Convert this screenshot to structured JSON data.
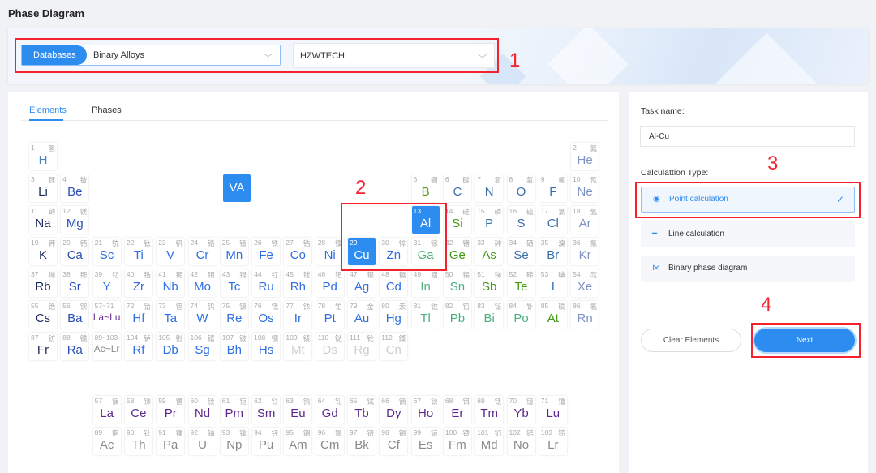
{
  "page_title": "Phase Diagram",
  "database": {
    "label": "Databases",
    "value": "Binary Alloys",
    "vendor": "HZWTECH"
  },
  "tabs": [
    {
      "label": "Elements",
      "active": true
    },
    {
      "label": "Phases",
      "active": false
    }
  ],
  "va_button": "VA",
  "category_colors": {
    "alkali": "#1c2b5c",
    "alkaline": "#2a4fb5",
    "transition": "#2f6fe4",
    "lanthanide_link": "#6a2e8f",
    "actinide_link": "#8c8c8c",
    "synthetic": "#cfcfcf",
    "boron": "#5c9a12",
    "nonmetal": "#3a6fa8",
    "noble": "#7f93c4",
    "poor": "#4bb07d",
    "metalloid": "#3f9a10",
    "hydrogen": "#4a84b6",
    "lanthanide": "#5b2a8c",
    "actinide": "#8a8a8a"
  },
  "selection_color": "#2d8cf0",
  "selected": [
    13,
    29
  ],
  "elements": [
    [
      1,
      "H",
      "氢",
      1,
      1,
      "hydrogen"
    ],
    [
      2,
      "He",
      "氦",
      1,
      18,
      "noble"
    ],
    [
      3,
      "Li",
      "锂",
      2,
      1,
      "alkali"
    ],
    [
      4,
      "Be",
      "铍",
      2,
      2,
      "alkaline"
    ],
    [
      5,
      "B",
      "硼",
      2,
      13,
      "boron"
    ],
    [
      6,
      "C",
      "碳",
      2,
      14,
      "nonmetal"
    ],
    [
      7,
      "N",
      "氮",
      2,
      15,
      "nonmetal"
    ],
    [
      8,
      "O",
      "氧",
      2,
      16,
      "nonmetal"
    ],
    [
      9,
      "F",
      "氟",
      2,
      17,
      "nonmetal"
    ],
    [
      10,
      "Ne",
      "氖",
      2,
      18,
      "noble"
    ],
    [
      11,
      "Na",
      "钠",
      3,
      1,
      "alkali"
    ],
    [
      12,
      "Mg",
      "镁",
      3,
      2,
      "alkaline"
    ],
    [
      13,
      "Al",
      "铝",
      3,
      13,
      "poor"
    ],
    [
      14,
      "Si",
      "硅",
      3,
      14,
      "metalloid"
    ],
    [
      15,
      "P",
      "磷",
      3,
      15,
      "nonmetal"
    ],
    [
      16,
      "S",
      "硫",
      3,
      16,
      "nonmetal"
    ],
    [
      17,
      "Cl",
      "氯",
      3,
      17,
      "nonmetal"
    ],
    [
      18,
      "Ar",
      "氩",
      3,
      18,
      "noble"
    ],
    [
      19,
      "K",
      "钾",
      4,
      1,
      "alkali"
    ],
    [
      20,
      "Ca",
      "钙",
      4,
      2,
      "alkaline"
    ],
    [
      21,
      "Sc",
      "钪",
      4,
      3,
      "transition"
    ],
    [
      22,
      "Ti",
      "钛",
      4,
      4,
      "transition"
    ],
    [
      23,
      "V",
      "钒",
      4,
      5,
      "transition"
    ],
    [
      24,
      "Cr",
      "铬",
      4,
      6,
      "transition"
    ],
    [
      25,
      "Mn",
      "锰",
      4,
      7,
      "transition"
    ],
    [
      26,
      "Fe",
      "铁",
      4,
      8,
      "transition"
    ],
    [
      27,
      "Co",
      "钴",
      4,
      9,
      "transition"
    ],
    [
      28,
      "Ni",
      "镍",
      4,
      10,
      "transition"
    ],
    [
      29,
      "Cu",
      "铜",
      4,
      11,
      "transition"
    ],
    [
      30,
      "Zn",
      "锌",
      4,
      12,
      "transition"
    ],
    [
      31,
      "Ga",
      "镓",
      4,
      13,
      "poor"
    ],
    [
      32,
      "Ge",
      "锗",
      4,
      14,
      "metalloid"
    ],
    [
      33,
      "As",
      "砷",
      4,
      15,
      "metalloid"
    ],
    [
      34,
      "Se",
      "硒",
      4,
      16,
      "nonmetal"
    ],
    [
      35,
      "Br",
      "溴",
      4,
      17,
      "nonmetal"
    ],
    [
      36,
      "Kr",
      "氪",
      4,
      18,
      "noble"
    ],
    [
      37,
      "Rb",
      "铷",
      5,
      1,
      "alkali"
    ],
    [
      38,
      "Sr",
      "锶",
      5,
      2,
      "alkaline"
    ],
    [
      39,
      "Y",
      "钇",
      5,
      3,
      "transition"
    ],
    [
      40,
      "Zr",
      "锆",
      5,
      4,
      "transition"
    ],
    [
      41,
      "Nb",
      "铌",
      5,
      5,
      "transition"
    ],
    [
      42,
      "Mo",
      "钼",
      5,
      6,
      "transition"
    ],
    [
      43,
      "Tc",
      "锝",
      5,
      7,
      "transition"
    ],
    [
      44,
      "Ru",
      "钌",
      5,
      8,
      "transition"
    ],
    [
      45,
      "Rh",
      "铑",
      5,
      9,
      "transition"
    ],
    [
      46,
      "Pd",
      "钯",
      5,
      10,
      "transition"
    ],
    [
      47,
      "Ag",
      "银",
      5,
      11,
      "transition"
    ],
    [
      48,
      "Cd",
      "镉",
      5,
      12,
      "transition"
    ],
    [
      49,
      "In",
      "铟",
      5,
      13,
      "poor"
    ],
    [
      50,
      "Sn",
      "锡",
      5,
      14,
      "poor"
    ],
    [
      51,
      "Sb",
      "锑",
      5,
      15,
      "metalloid"
    ],
    [
      52,
      "Te",
      "碲",
      5,
      16,
      "metalloid"
    ],
    [
      53,
      "I",
      "碘",
      5,
      17,
      "nonmetal"
    ],
    [
      54,
      "Xe",
      "氙",
      5,
      18,
      "noble"
    ],
    [
      55,
      "Cs",
      "铯",
      6,
      1,
      "alkali"
    ],
    [
      56,
      "Ba",
      "钡",
      6,
      2,
      "alkaline"
    ],
    [
      "57~71",
      "La~Lu",
      "",
      6,
      3,
      "lanthanide_link"
    ],
    [
      72,
      "Hf",
      "铪",
      6,
      4,
      "transition"
    ],
    [
      73,
      "Ta",
      "钽",
      6,
      5,
      "transition"
    ],
    [
      74,
      "W",
      "钨",
      6,
      6,
      "transition"
    ],
    [
      75,
      "Re",
      "铼",
      6,
      7,
      "transition"
    ],
    [
      76,
      "Os",
      "锇",
      6,
      8,
      "transition"
    ],
    [
      77,
      "Ir",
      "铱",
      6,
      9,
      "transition"
    ],
    [
      78,
      "Pt",
      "铂",
      6,
      10,
      "transition"
    ],
    [
      79,
      "Au",
      "金",
      6,
      11,
      "transition"
    ],
    [
      80,
      "Hg",
      "汞",
      6,
      12,
      "transition"
    ],
    [
      81,
      "Tl",
      "铊",
      6,
      13,
      "poor"
    ],
    [
      82,
      "Pb",
      "铅",
      6,
      14,
      "poor"
    ],
    [
      83,
      "Bi",
      "铋",
      6,
      15,
      "poor"
    ],
    [
      84,
      "Po",
      "钋",
      6,
      16,
      "poor"
    ],
    [
      85,
      "At",
      "砹",
      6,
      17,
      "metalloid"
    ],
    [
      86,
      "Rn",
      "氡",
      6,
      18,
      "noble"
    ],
    [
      87,
      "Fr",
      "钫",
      7,
      1,
      "alkali"
    ],
    [
      88,
      "Ra",
      "镭",
      7,
      2,
      "alkaline"
    ],
    [
      "89~103",
      "Ac~Lr",
      "",
      7,
      3,
      "actinide_link"
    ],
    [
      104,
      "Rf",
      "𬬻",
      7,
      4,
      "transition"
    ],
    [
      105,
      "Db",
      "𬭊",
      7,
      5,
      "transition"
    ],
    [
      106,
      "Sg",
      "𬭳",
      7,
      6,
      "transition"
    ],
    [
      107,
      "Bh",
      "𬭛",
      7,
      7,
      "transition"
    ],
    [
      108,
      "Hs",
      "𬭶",
      7,
      8,
      "transition"
    ],
    [
      109,
      "Mt",
      "鿏",
      7,
      9,
      "synthetic"
    ],
    [
      110,
      "Ds",
      "𫟼",
      7,
      10,
      "synthetic"
    ],
    [
      111,
      "Rg",
      "𬬭",
      7,
      11,
      "synthetic"
    ],
    [
      112,
      "Cn",
      "鎶",
      7,
      12,
      "synthetic"
    ],
    [
      57,
      "La",
      "镧",
      9,
      3,
      "lanthanide"
    ],
    [
      58,
      "Ce",
      "铈",
      9,
      4,
      "lanthanide"
    ],
    [
      59,
      "Pr",
      "镨",
      9,
      5,
      "lanthanide"
    ],
    [
      60,
      "Nd",
      "钕",
      9,
      6,
      "lanthanide"
    ],
    [
      61,
      "Pm",
      "钷",
      9,
      7,
      "lanthanide"
    ],
    [
      62,
      "Sm",
      "钐",
      9,
      8,
      "lanthanide"
    ],
    [
      63,
      "Eu",
      "铕",
      9,
      9,
      "lanthanide"
    ],
    [
      64,
      "Gd",
      "钆",
      9,
      10,
      "lanthanide"
    ],
    [
      65,
      "Tb",
      "铽",
      9,
      11,
      "lanthanide"
    ],
    [
      66,
      "Dy",
      "镝",
      9,
      12,
      "lanthanide"
    ],
    [
      67,
      "Ho",
      "钬",
      9,
      13,
      "lanthanide"
    ],
    [
      68,
      "Er",
      "铒",
      9,
      14,
      "lanthanide"
    ],
    [
      69,
      "Tm",
      "铥",
      9,
      15,
      "lanthanide"
    ],
    [
      70,
      "Yb",
      "镱",
      9,
      16,
      "lanthanide"
    ],
    [
      71,
      "Lu",
      "镥",
      9,
      17,
      "lanthanide"
    ],
    [
      89,
      "Ac",
      "锕",
      10,
      3,
      "actinide"
    ],
    [
      90,
      "Th",
      "钍",
      10,
      4,
      "actinide"
    ],
    [
      91,
      "Pa",
      "镤",
      10,
      5,
      "actinide"
    ],
    [
      92,
      "U",
      "铀",
      10,
      6,
      "actinide"
    ],
    [
      93,
      "Np",
      "镎",
      10,
      7,
      "actinide"
    ],
    [
      94,
      "Pu",
      "钚",
      10,
      8,
      "actinide"
    ],
    [
      95,
      "Am",
      "镅",
      10,
      9,
      "actinide"
    ],
    [
      96,
      "Cm",
      "锔",
      10,
      10,
      "actinide"
    ],
    [
      97,
      "Bk",
      "锫",
      10,
      11,
      "actinide"
    ],
    [
      98,
      "Cf",
      "锎",
      10,
      12,
      "actinide"
    ],
    [
      99,
      "Es",
      "锿",
      10,
      13,
      "actinide"
    ],
    [
      100,
      "Fm",
      "镄",
      10,
      14,
      "actinide"
    ],
    [
      101,
      "Md",
      "钔",
      10,
      15,
      "actinide"
    ],
    [
      102,
      "No",
      "锘",
      10,
      16,
      "actinide"
    ],
    [
      103,
      "Lr",
      "铹",
      10,
      17,
      "actinide"
    ]
  ],
  "task": {
    "label": "Task name:",
    "value": "Al-Cu"
  },
  "calc": {
    "label": "Calculattion Type:",
    "options": [
      {
        "label": "Point calculation",
        "icon": "radio-dot-icon",
        "selected": true
      },
      {
        "label": "Line calculation",
        "icon": "line-icon",
        "selected": false
      },
      {
        "label": "Binary phase diagram",
        "icon": "diagram-icon",
        "selected": false
      }
    ],
    "check": "✓"
  },
  "buttons": {
    "clear": "Clear Elements",
    "next": "Next"
  },
  "annotations": [
    "1",
    "2",
    "3",
    "4"
  ]
}
